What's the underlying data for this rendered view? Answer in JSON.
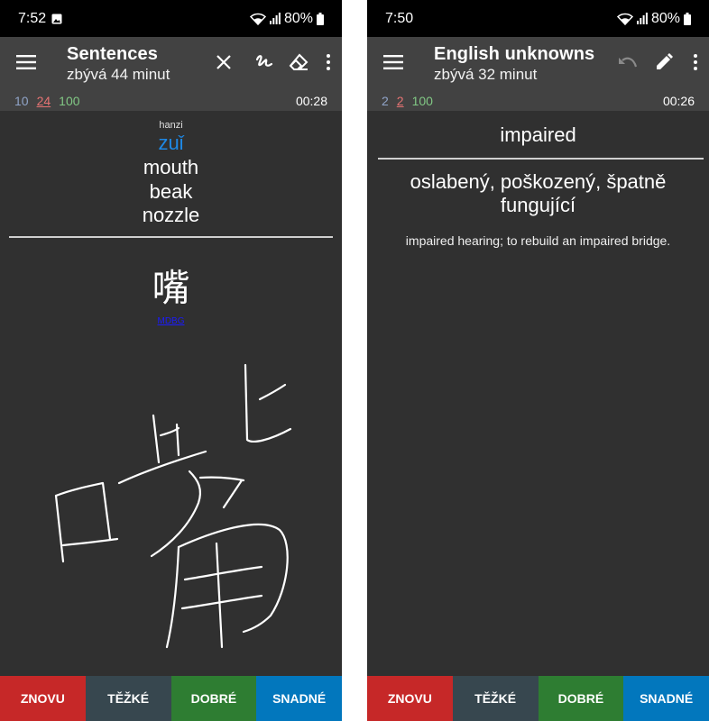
{
  "left": {
    "status": {
      "time": "7:52",
      "battery": "80%"
    },
    "app_bar": {
      "title": "Sentences",
      "subtitle": "zbývá 44 minut"
    },
    "counts": {
      "new": "10",
      "learning": "24",
      "review": "100",
      "timer": "00:28"
    },
    "card": {
      "label": "hanzi",
      "pinyin": "zuǐ",
      "meanings": [
        "mouth",
        "beak",
        "nozzle"
      ],
      "character": "嘴",
      "link": "MDBG"
    },
    "buttons": {
      "again": "ZNOVU",
      "hard": "TĚŽKÉ",
      "good": "DOBRÉ",
      "easy": "SNADNÉ"
    }
  },
  "right": {
    "status": {
      "time": "7:50",
      "battery": "80%"
    },
    "app_bar": {
      "title": "English unknowns",
      "subtitle": "zbývá 32 minut"
    },
    "counts": {
      "new": "2",
      "learning": "2",
      "review": "100",
      "timer": "00:26"
    },
    "card": {
      "front": "impaired",
      "translation": "oslabený, poškozený, špatně fungující",
      "example": "impaired hearing; to rebuild an impaired bridge."
    },
    "buttons": {
      "again": "ZNOVU",
      "hard": "TĚŽKÉ",
      "good": "DOBRÉ",
      "easy": "SNADNÉ"
    }
  },
  "colors": {
    "again": "#c62828",
    "hard": "#37474f",
    "good": "#2e7d32",
    "easy": "#0277bd",
    "pinyin": "#1e88e5",
    "new_count": "#90a4c8",
    "learn_count": "#e57373",
    "review_count": "#81c784"
  },
  "icons": [
    "menu-icon",
    "close-icon",
    "whiteboard-pen-icon",
    "eraser-icon",
    "more-vert-icon",
    "undo-icon",
    "edit-icon",
    "wifi-icon",
    "signal-icon",
    "battery-icon",
    "gallery-icon"
  ]
}
